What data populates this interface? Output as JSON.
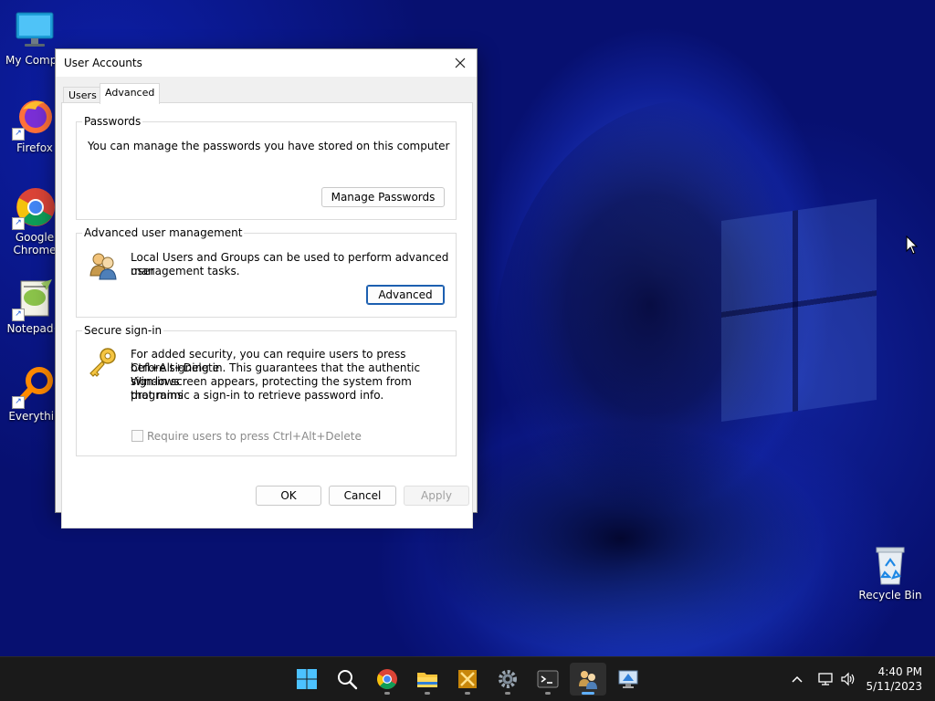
{
  "desktop": {
    "icons": [
      {
        "label": "My Compu",
        "icon": "computer-icon"
      },
      {
        "label": "Firefox",
        "icon": "firefox-icon"
      },
      {
        "label": "Google Chrome",
        "icon": "chrome-icon"
      },
      {
        "label": "Notepad+",
        "icon": "notepad-plus-icon"
      },
      {
        "label": "Everythin",
        "icon": "everything-search-icon"
      },
      {
        "label": "Recycle Bin",
        "icon": "recycle-bin-icon"
      }
    ]
  },
  "dialog": {
    "title": "User Accounts",
    "tabs": [
      {
        "label": "Users",
        "active": false
      },
      {
        "label": "Advanced",
        "active": true
      }
    ],
    "passwords": {
      "legend": "Passwords",
      "description": "You can manage the passwords you have stored on this computer",
      "button": "Manage Passwords"
    },
    "advanced_user_management": {
      "legend": "Advanced user management",
      "description_line1": "Local Users and Groups can be used to perform advanced user",
      "description_line2": "management tasks.",
      "button": "Advanced"
    },
    "secure_signin": {
      "legend": "Secure sign-in",
      "line1": "For added security, you can require users to press Ctrl+Alt+Delete",
      "line2": "before signing in. This guarantees that the authentic Windows",
      "line3": "sign-in screen appears, protecting the system from programs",
      "line4": "that mimic a sign-in to retrieve password info.",
      "checkbox_label": "Require users to press Ctrl+Alt+Delete",
      "checkbox_checked": false,
      "checkbox_enabled": false
    },
    "buttons": {
      "ok": "OK",
      "cancel": "Cancel",
      "apply": "Apply"
    }
  },
  "taskbar": {
    "items": [
      "start-icon",
      "search-icon",
      "chrome-icon",
      "file-explorer-icon",
      "ftp-client-icon",
      "settings-icon",
      "terminal-icon",
      "user-accounts-icon",
      "remote-desktop-icon"
    ],
    "active_item": "user-accounts-icon",
    "clock": {
      "time": "4:40 PM",
      "date": "5/11/2023"
    }
  },
  "colors": {
    "accent": "#1c5fb0",
    "taskbar_bg": "#1a1a1a"
  }
}
